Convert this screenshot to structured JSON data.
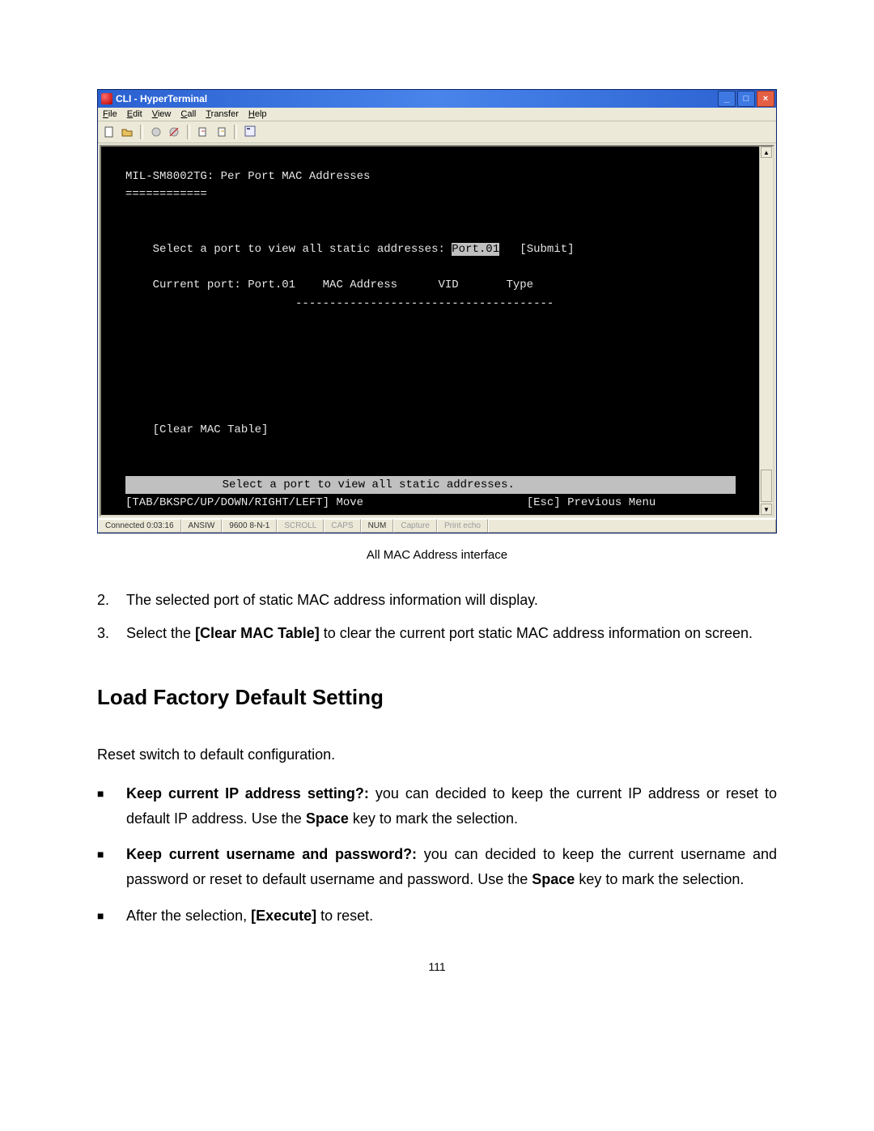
{
  "window": {
    "title": "CLI - HyperTerminal",
    "menus": {
      "file": "File",
      "edit": "Edit",
      "view": "View",
      "call": "Call",
      "transfer": "Transfer",
      "help": "Help"
    }
  },
  "terminal": {
    "header": "MIL-SM8002TG: Per Port MAC Addresses",
    "underline": "============",
    "select_prompt": "Select a port to view all static addresses: ",
    "port_highlight": "Port.01",
    "submit": "   [Submit]",
    "current_line": "Current port: Port.01    MAC Address      VID       Type",
    "dashes": "                         --------------------------------------",
    "clear": "[Clear MAC Table]",
    "bottom_center": "Select a port to view all static addresses.",
    "nav_left": "[TAB/BKSPC/UP/DOWN/RIGHT/LEFT] Move",
    "nav_right": "[Esc] Previous Menu"
  },
  "statusbar": {
    "connected": "Connected 0:03:16",
    "emu": "ANSIW",
    "conn": "9600 8-N-1",
    "scroll": "SCROLL",
    "caps": "CAPS",
    "num": "NUM",
    "capture": "Capture",
    "echo": "Print echo"
  },
  "caption": "All MAC Address interface",
  "list": {
    "item2_num": "2.",
    "item2_text": "The selected port of static MAC address information will display.",
    "item3_num": "3.",
    "item3_pre": "Select the ",
    "item3_bold": "[Clear MAC Table]",
    "item3_post": " to clear the current port static MAC address information on screen."
  },
  "section_heading": "Load Factory Default Setting",
  "reset_intro": "Reset switch to default configuration.",
  "bullets": {
    "b1_bold": "Keep current IP address setting?:",
    "b1_mid": " you can decided to keep the current IP address or reset to default IP address. Use the ",
    "b1_space": "Space",
    "b1_end": " key to mark the selection.",
    "b2_bold": "Keep current username and password?:",
    "b2_mid": " you can decided to keep the current username and password or reset to default username and password. Use the ",
    "b2_space": "Space",
    "b2_end": " key to mark the selection.",
    "b3_pre": "After the selection, ",
    "b3_bold": "[Execute]",
    "b3_post": " to reset."
  },
  "page_number": "111"
}
